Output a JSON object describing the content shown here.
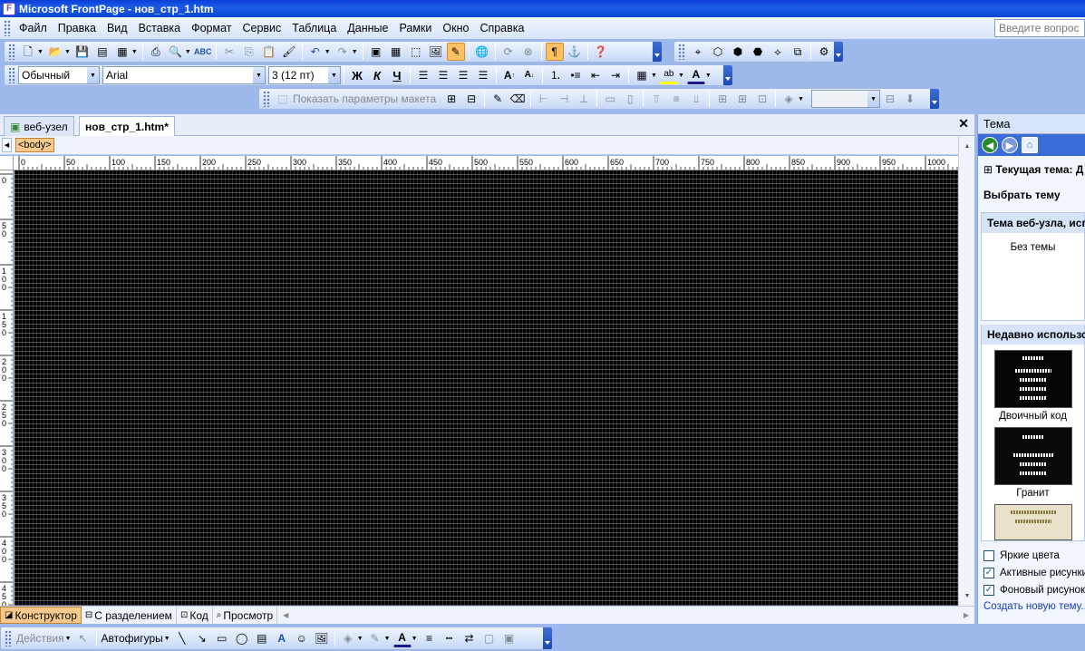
{
  "window": {
    "title": "Microsoft FrontPage - нов_стр_1.htm",
    "app_icon": "frontpage-icon"
  },
  "menu": {
    "items": [
      "Файл",
      "Правка",
      "Вид",
      "Вставка",
      "Формат",
      "Сервис",
      "Таблица",
      "Данные",
      "Рамки",
      "Окно",
      "Справка"
    ],
    "ask_placeholder": "Введите вопрос"
  },
  "formatting": {
    "style": "Обычный",
    "font": "Arial",
    "size": "3 (12 пт)",
    "bold": "Ж",
    "italic": "К",
    "underline": "Ч"
  },
  "layout_toolbar": {
    "show_params_label": "Показать параметры макета"
  },
  "tabs": [
    {
      "label": "веб-узел",
      "active": false
    },
    {
      "label": "нов_стр_1.htm*",
      "active": true
    }
  ],
  "tag_selector": {
    "tag": "<body>"
  },
  "ruler": {
    "h_labels": [
      "0",
      "50",
      "100",
      "150",
      "200",
      "250",
      "300",
      "350",
      "400",
      "450",
      "500",
      "550",
      "600",
      "650",
      "700",
      "750",
      "800",
      "850",
      "900",
      "950",
      "1000"
    ],
    "v_labels": [
      "0",
      "50",
      "100",
      "150",
      "200",
      "250",
      "300",
      "350",
      "400",
      "450"
    ]
  },
  "view_tabs": [
    {
      "label": "Конструктор",
      "active": true
    },
    {
      "label": "С разделением",
      "active": false
    },
    {
      "label": "Код",
      "active": false
    },
    {
      "label": "Просмотр",
      "active": false
    }
  ],
  "drawing": {
    "actions_label": "Действия",
    "autoshapes_label": "Автофигуры"
  },
  "taskpane": {
    "title": "Тема",
    "current_theme": "Текущая тема: Д",
    "choose_theme": "Выбрать тему",
    "site_theme_header": "Тема веб-узла, исп",
    "no_theme": "Без темы",
    "recent_header": "Недавно использо",
    "themes": [
      {
        "label": "Двоичный код"
      },
      {
        "label": "Гранит"
      }
    ],
    "options": [
      {
        "label": "Яркие цвета",
        "checked": false
      },
      {
        "label": "Активные рисунки",
        "checked": true
      },
      {
        "label": "Фоновый рисунок",
        "checked": true
      }
    ],
    "create_link": "Создать новую тему..."
  }
}
